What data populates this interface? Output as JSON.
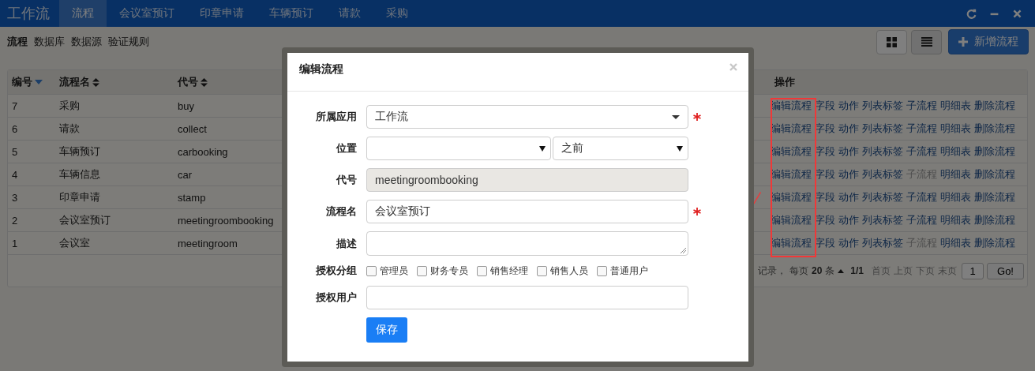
{
  "app_title": "工作流",
  "nav_tabs": [
    {
      "label": "流程",
      "selected": true
    },
    {
      "label": "会议室预订",
      "selected": false
    },
    {
      "label": "印章申请",
      "selected": false
    },
    {
      "label": "车辆预订",
      "selected": false
    },
    {
      "label": "请款",
      "selected": false
    },
    {
      "label": "采购",
      "selected": false
    }
  ],
  "sub_nav": [
    {
      "label": "流程",
      "selected": true
    },
    {
      "label": "数据库",
      "selected": false
    },
    {
      "label": "数据源",
      "selected": false
    },
    {
      "label": "验证规则",
      "selected": false
    }
  ],
  "view_buttons": [
    {
      "kind": "grid",
      "selected": false
    },
    {
      "kind": "list",
      "selected": true
    }
  ],
  "add_button": "新增流程",
  "table": {
    "columns": [
      {
        "label": "编号",
        "sorted": true
      },
      {
        "label": "流程名",
        "sorted": false
      },
      {
        "label": "代号",
        "sorted": false
      },
      {
        "label": "操作"
      }
    ],
    "rows": [
      {
        "id": "7",
        "name": "采购",
        "code": "buy",
        "actions": [
          {
            "label": "编辑流程",
            "disabled": false
          },
          {
            "label": "字段",
            "disabled": false
          },
          {
            "label": "动作",
            "disabled": false
          },
          {
            "label": "列表标签",
            "disabled": false
          },
          {
            "label": "子流程",
            "disabled": false
          },
          {
            "label": "明细表",
            "disabled": false
          },
          {
            "label": "删除流程",
            "disabled": false
          }
        ]
      },
      {
        "id": "6",
        "name": "请款",
        "code": "collect",
        "actions": [
          {
            "label": "编辑流程",
            "disabled": false
          },
          {
            "label": "字段",
            "disabled": false
          },
          {
            "label": "动作",
            "disabled": false
          },
          {
            "label": "列表标签",
            "disabled": false
          },
          {
            "label": "子流程",
            "disabled": false
          },
          {
            "label": "明细表",
            "disabled": false
          },
          {
            "label": "删除流程",
            "disabled": false
          }
        ]
      },
      {
        "id": "5",
        "name": "车辆预订",
        "code": "carbooking",
        "actions": [
          {
            "label": "编辑流程",
            "disabled": false
          },
          {
            "label": "字段",
            "disabled": false
          },
          {
            "label": "动作",
            "disabled": false
          },
          {
            "label": "列表标签",
            "disabled": false
          },
          {
            "label": "子流程",
            "disabled": false
          },
          {
            "label": "明细表",
            "disabled": false
          },
          {
            "label": "删除流程",
            "disabled": false
          }
        ]
      },
      {
        "id": "4",
        "name": "车辆信息",
        "code": "car",
        "actions": [
          {
            "label": "编辑流程",
            "disabled": false
          },
          {
            "label": "字段",
            "disabled": false
          },
          {
            "label": "动作",
            "disabled": false
          },
          {
            "label": "列表标签",
            "disabled": false
          },
          {
            "label": "子流程",
            "disabled": true
          },
          {
            "label": "明细表",
            "disabled": false
          },
          {
            "label": "删除流程",
            "disabled": false
          }
        ]
      },
      {
        "id": "3",
        "name": "印章申请",
        "code": "stamp",
        "actions": [
          {
            "label": "编辑流程",
            "disabled": false
          },
          {
            "label": "字段",
            "disabled": false
          },
          {
            "label": "动作",
            "disabled": false
          },
          {
            "label": "列表标签",
            "disabled": false
          },
          {
            "label": "子流程",
            "disabled": false
          },
          {
            "label": "明细表",
            "disabled": false
          },
          {
            "label": "删除流程",
            "disabled": false
          }
        ]
      },
      {
        "id": "2",
        "name": "会议室预订",
        "code": "meetingroombooking",
        "actions": [
          {
            "label": "编辑流程",
            "disabled": false
          },
          {
            "label": "字段",
            "disabled": false
          },
          {
            "label": "动作",
            "disabled": false
          },
          {
            "label": "列表标签",
            "disabled": false
          },
          {
            "label": "子流程",
            "disabled": false
          },
          {
            "label": "明细表",
            "disabled": false
          },
          {
            "label": "删除流程",
            "disabled": false
          }
        ]
      },
      {
        "id": "1",
        "name": "会议室",
        "code": "meetingroom",
        "actions": [
          {
            "label": "编辑流程",
            "disabled": false
          },
          {
            "label": "字段",
            "disabled": false
          },
          {
            "label": "动作",
            "disabled": false
          },
          {
            "label": "列表标签",
            "disabled": false
          },
          {
            "label": "子流程",
            "disabled": true
          },
          {
            "label": "明细表",
            "disabled": false
          },
          {
            "label": "删除流程",
            "disabled": false
          }
        ]
      }
    ]
  },
  "pagination": {
    "summary": "记录，",
    "per_page_label": "每页",
    "per_page": "20",
    "per_page_unit": "条",
    "pages": "1/1",
    "links": [
      "首页",
      "上页",
      "下页",
      "末页"
    ],
    "page_input": "1",
    "go": "Go!"
  },
  "modal": {
    "title": "编辑流程",
    "fields": [
      {
        "kind": "select",
        "label": "所属应用",
        "value": "工作流",
        "required": true
      },
      {
        "kind": "select-pair",
        "label": "位置",
        "value_2": "之前",
        "required": false
      },
      {
        "kind": "readonly",
        "label": "代号",
        "value": "meetingroombooking",
        "required": false
      },
      {
        "kind": "text",
        "label": "流程名",
        "value": "会议室预订",
        "required": true
      },
      {
        "kind": "textarea",
        "label": "描述",
        "required": false
      },
      {
        "kind": "checkboxes",
        "label": "授权分组",
        "required": false,
        "options": [
          {
            "label": "管理员",
            "checked": false
          },
          {
            "label": "财务专员",
            "checked": false
          },
          {
            "label": "销售经理",
            "checked": false
          },
          {
            "label": "销售人员",
            "checked": false
          },
          {
            "label": "普通用户",
            "checked": false
          }
        ]
      },
      {
        "kind": "text",
        "label": "授权用户",
        "required": false
      }
    ],
    "save": "保存"
  }
}
